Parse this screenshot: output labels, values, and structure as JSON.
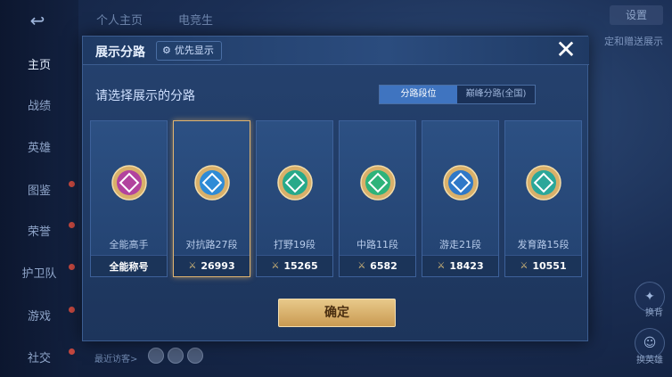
{
  "background": {
    "sidebar": [
      {
        "label": "主页",
        "active": true
      },
      {
        "label": "战绩",
        "active": false
      },
      {
        "label": "英雄",
        "active": false
      },
      {
        "label": "图鉴",
        "active": false,
        "dot": true
      },
      {
        "label": "荣誉",
        "active": false,
        "dot": true
      },
      {
        "label": "护卫队",
        "active": false,
        "dot": true
      },
      {
        "label": "游戏",
        "active": false,
        "dot": true
      },
      {
        "label": "社交",
        "active": false,
        "dot": true
      }
    ],
    "top_tabs": [
      "个人主页",
      "电竞生"
    ],
    "settings_label": "设置",
    "right_text": "定和赠送展示",
    "right_labels": [
      "换背",
      "换英雄"
    ],
    "visitors_label": "最近访客>"
  },
  "modal": {
    "title": "展示分路",
    "priority_label": "优先显示",
    "subtitle": "请选择展示的分路",
    "toggle": [
      {
        "label": "分路段位",
        "active": true
      },
      {
        "label": "巅峰分路(全国)",
        "active": false
      }
    ],
    "cards": [
      {
        "label": "全能高手",
        "value": "全能称号",
        "badge_color": "#b2439e",
        "show_icon": false,
        "selected": false
      },
      {
        "label": "对抗路27段",
        "value": "26993",
        "badge_color": "#2f8bd6",
        "show_icon": true,
        "selected": true
      },
      {
        "label": "打野19段",
        "value": "15265",
        "badge_color": "#27a98a",
        "show_icon": true,
        "selected": false
      },
      {
        "label": "中路11段",
        "value": "6582",
        "badge_color": "#2fb37a",
        "show_icon": true,
        "selected": false
      },
      {
        "label": "游走21段",
        "value": "18423",
        "badge_color": "#2f78c8",
        "show_icon": true,
        "selected": false
      },
      {
        "label": "发育路15段",
        "value": "10551",
        "badge_color": "#2aa79a",
        "show_icon": true,
        "selected": false
      }
    ],
    "confirm_label": "确定"
  }
}
